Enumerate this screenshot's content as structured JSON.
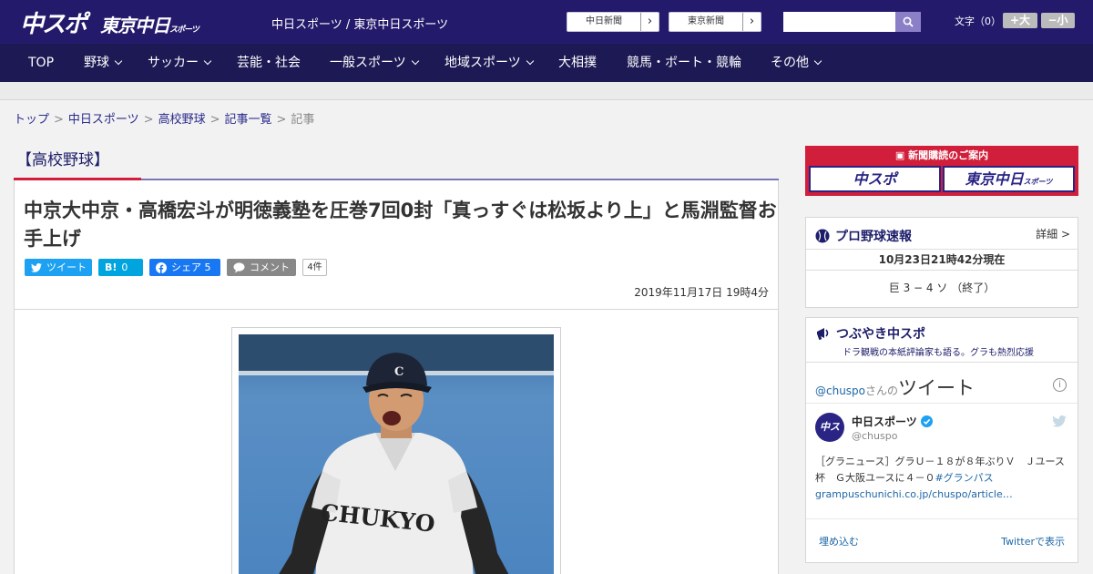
{
  "header": {
    "logo_main": "中スポ",
    "logo_sub": "東京中日",
    "logo_sub_small": "スポーツ",
    "site_name": "中日スポーツ / 東京中日スポーツ",
    "ext_links": [
      "中日新聞",
      "東京新聞"
    ],
    "search_placeholder": "",
    "font_size_label": "文字（0）",
    "font_up": "+大",
    "font_down": "−小"
  },
  "nav": [
    {
      "label": "TOP",
      "dropdown": false
    },
    {
      "label": "野球",
      "dropdown": true
    },
    {
      "label": "サッカー",
      "dropdown": true
    },
    {
      "label": "芸能・社会",
      "dropdown": false
    },
    {
      "label": "一般スポーツ",
      "dropdown": true
    },
    {
      "label": "地域スポーツ",
      "dropdown": true
    },
    {
      "label": "大相撲",
      "dropdown": false
    },
    {
      "label": "競馬・ボート・競輪",
      "dropdown": false
    },
    {
      "label": "その他",
      "dropdown": true
    }
  ],
  "breadcrumb": {
    "items": [
      "トップ",
      "中日スポーツ",
      "高校野球",
      "記事一覧"
    ],
    "sep": ">",
    "current": "記事"
  },
  "category": "【高校野球】",
  "article": {
    "title": "中京大中京・高橋宏斗が明徳義塾を圧巻7回0封「真っすぐは松坂より上」と馬淵監督お手上げ",
    "share": {
      "tweet": "ツイート",
      "hatena_icon": "B!",
      "hatena_count": "0",
      "facebook": "シェア",
      "facebook_count": "5",
      "comment": "コメント",
      "comment_count": "4件"
    },
    "date": "2019年11月17日 19時4分",
    "photo_text": "CHUKYO"
  },
  "sidebar": {
    "subscribe": {
      "header": "新聞購読のご案内",
      "buttons": [
        "中スポ",
        "東京中日"
      ],
      "small": "スポーツ"
    },
    "baseball": {
      "title": "プロ野球速報",
      "more": "詳細 >",
      "time": "10月23日21時42分現在",
      "score": "巨 3 − 4 ソ （終了）"
    },
    "tsubuyaki": {
      "title": "つぶやき中スポ",
      "subtitle": "ドラ観戦の本紙評論家も語る。グラも熱烈応援",
      "timeline_user": "@chuspo",
      "timeline_san": "さんの",
      "timeline_head": "ツイート",
      "account_name": "中日スポーツ",
      "account_handle": "@chuspo",
      "avatar_text": "中スポ",
      "tweet_text": "［グラニュース］グラＵ－１８が８年ぶりＶ　Ｊユース杯　Ｇ大阪ユースに４－０",
      "tweet_hashtag": "#グランパス",
      "tweet_link": "grampuschunichi.co.jp/chuspo/article…",
      "embed": "埋め込む",
      "view": "Twitterで表示"
    }
  },
  "colors": {
    "header_bg": "#231a6b",
    "nav_bg": "#1d1954",
    "accent_red": "#d11e3a",
    "twitter_blue": "#1da1f2",
    "facebook_blue": "#1877f2"
  }
}
